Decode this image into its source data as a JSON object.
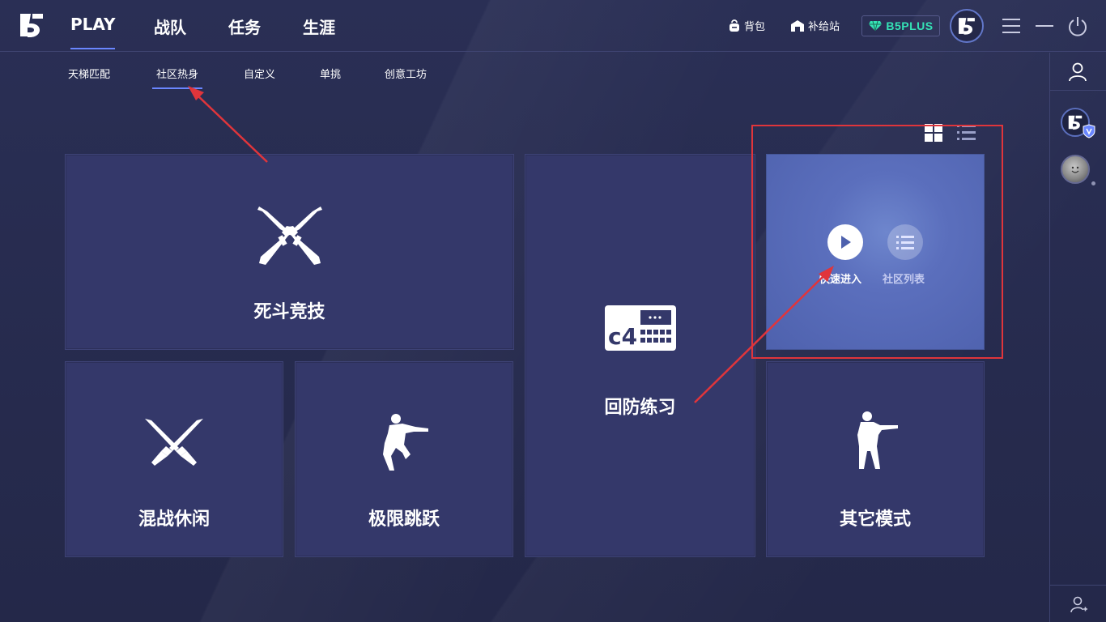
{
  "topbar": {
    "tabs": [
      "PLAY",
      "战队",
      "任务",
      "生涯"
    ],
    "backpack": "背包",
    "supply": "补给站",
    "plus": "B5PLUS"
  },
  "subtabs": [
    "天梯匹配",
    "社区热身",
    "自定义",
    "单挑",
    "创意工坊"
  ],
  "cards": {
    "deathmatch": "死斗竞技",
    "retake": "回防练习",
    "casual": "混战休闲",
    "jump": "极限跳跃",
    "other": "其它模式"
  },
  "highlight": {
    "quick_join": "快速进入",
    "community_list": "社区列表"
  },
  "colors": {
    "accent": "#6a86ff",
    "plus": "#35e3b6",
    "annotation": "#e0353b"
  }
}
